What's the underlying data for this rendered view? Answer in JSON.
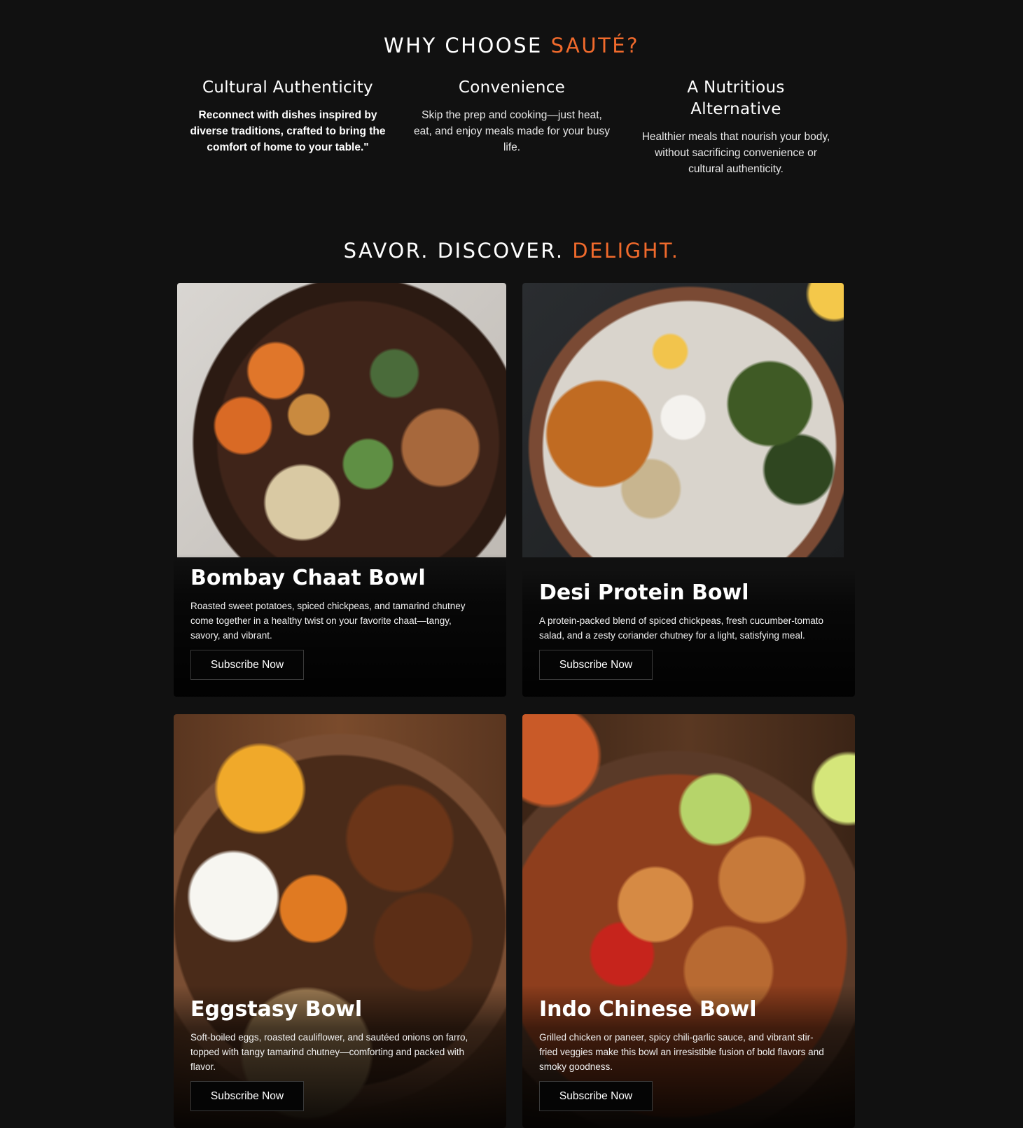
{
  "why": {
    "title_prefix": "WHY CHOOSE ",
    "title_accent": "SAUTÉ?",
    "features": [
      {
        "title": "Cultural Authenticity",
        "text": "Reconnect with dishes inspired by diverse traditions, crafted to bring the comfort of home to your table.\""
      },
      {
        "title": "Convenience",
        "text": "Skip the prep and cooking—just heat, eat, and enjoy meals made for your busy life."
      },
      {
        "title": "A Nutritious Alternative",
        "text": "Healthier meals that nourish your body, without sacrificing convenience or cultural authenticity."
      }
    ]
  },
  "savor": {
    "title_prefix": "SAVOR. DISCOVER. ",
    "title_accent": "DELIGHT."
  },
  "bowls": [
    {
      "name": "Bombay Chaat Bowl",
      "description": "Roasted sweet potatoes, spiced chickpeas, and tamarind chutney come together in a healthy twist on your favorite chaat—tangy, savory, and vibrant.",
      "button": "Subscribe Now"
    },
    {
      "name": "Desi Protein Bowl",
      "description": "A protein-packed blend of spiced chickpeas, fresh cucumber-tomato salad, and a zesty coriander chutney for a light, satisfying meal.",
      "button": "Subscribe Now"
    },
    {
      "name": "Eggstasy Bowl",
      "description": "Soft-boiled eggs, roasted cauliflower, and sautéed onions on farro, topped with tangy tamarind chutney—comforting and packed with flavor.",
      "button": "Subscribe Now"
    },
    {
      "name": "Indo Chinese Bowl",
      "description": "Grilled chicken or paneer, spicy chili-garlic sauce, and vibrant stir-fried veggies make this bowl an irresistible fusion of bold flavors and smoky goodness.",
      "button": "Subscribe Now"
    }
  ],
  "colors": {
    "background": "#111111",
    "accent": "#f06a2c",
    "text": "#ffffff"
  }
}
